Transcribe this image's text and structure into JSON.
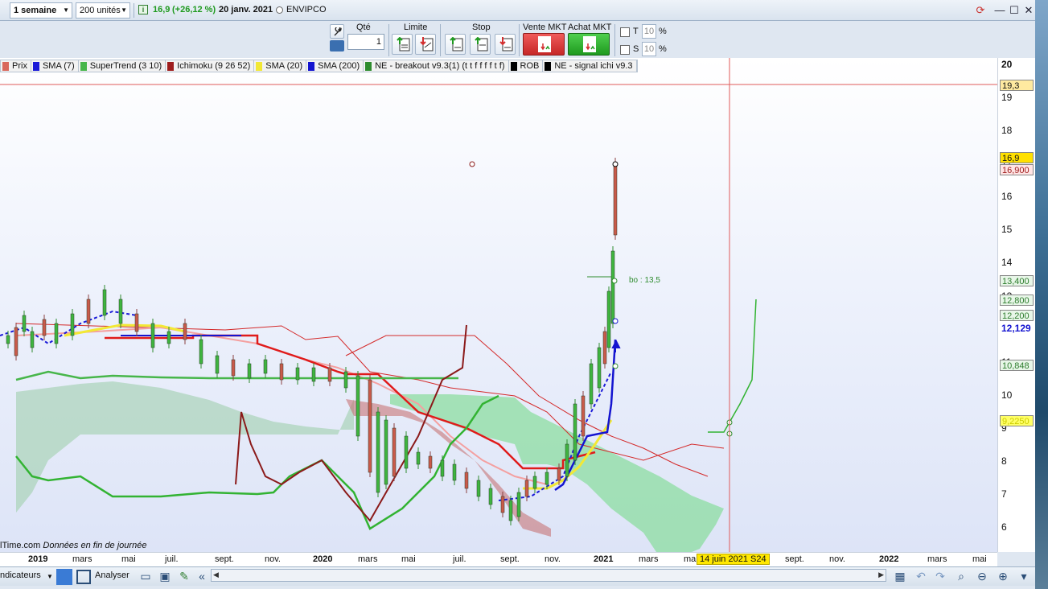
{
  "topbar": {
    "period": "1 semaine",
    "units": "200 unités",
    "price": "16,9",
    "change": "(+26,12 %)",
    "date": "20 janv. 2021",
    "ticker": "ENVIPCO"
  },
  "order_toolbar": {
    "qte_label": "Qté",
    "qte_value": "1",
    "limite_label": "Limite",
    "stop_label": "Stop",
    "vente_label": "Vente MKT",
    "achat_label": "Achat MKT",
    "t_label": "T",
    "s_label": "S",
    "t_value": "10",
    "s_value": "10",
    "pct": "%"
  },
  "legend": [
    {
      "label": "Prix",
      "color": "#d9685c"
    },
    {
      "label": "SMA (7)",
      "color": "#1a1ad8"
    },
    {
      "label": "SuperTrend (3 10)",
      "color": "#47b64a"
    },
    {
      "label": "Ichimoku (9 26 52)",
      "color": "#9e1d1d"
    },
    {
      "label": "SMA (20)",
      "color": "#f2e835"
    },
    {
      "label": "SMA (200)",
      "color": "#1414d0"
    },
    {
      "label": "NE - breakout v9.3(1) (t t f f f f t f)",
      "color": "#2e8c2e"
    },
    {
      "label": "ROB",
      "color": "#000000"
    },
    {
      "label": "NE - signal ichi v9.3",
      "color": "#000000"
    }
  ],
  "y_axis": {
    "ticks": [
      "20",
      "19",
      "18",
      "17",
      "16",
      "15",
      "14",
      "13",
      "12",
      "11",
      "10",
      "9",
      "8",
      "7",
      "6"
    ],
    "tags": [
      {
        "label": "19,3",
        "bg": "#ffeaa0",
        "fg": "#111111"
      },
      {
        "label": "16,9",
        "bg": "#ffe000",
        "fg": "#111111"
      },
      {
        "label": "16,900",
        "bg": "#ffe4e4",
        "fg": "#9e1d1d"
      },
      {
        "label": "13,400",
        "bg": "#e8f6e8",
        "fg": "#2e7d2e"
      },
      {
        "label": "12,800",
        "bg": "#e8f6e8",
        "fg": "#2e7d2e"
      },
      {
        "label": "12,200",
        "bg": "#e8f6e8",
        "fg": "#2e7d2e"
      },
      {
        "label": "12,129",
        "bg": "#ffffff",
        "fg": "#1414d0"
      },
      {
        "label": "10,848",
        "bg": "#e8f6e8",
        "fg": "#2e7d2e"
      },
      {
        "label": "9,2250",
        "bg": "#ffff66",
        "fg": "#cccc00"
      }
    ]
  },
  "time_axis": [
    "2019",
    "mars",
    "mai",
    "juil.",
    "sept.",
    "nov.",
    "2020",
    "mars",
    "mai",
    "juil.",
    "sept.",
    "nov.",
    "2021",
    "mars",
    "mai",
    "sept.",
    "nov.",
    "2022",
    "mars",
    "mai"
  ],
  "crosshair_date": "14 juin 2021 S24",
  "annotation": "bo : 13,5",
  "footer_note_prefix": "lTime.com",
  "footer_note": "Données en fin de journée",
  "bottombar": {
    "indicators": "ndicateurs",
    "analyser": "Analyser"
  },
  "chart_data": {
    "type": "line",
    "title": "ENVIPCO",
    "xlabel": "",
    "ylabel": "",
    "ylim": [
      5.5,
      20.5
    ],
    "series": [
      {
        "name": "Prix",
        "x": [
          "2019-01",
          "2019-02",
          "2019-03",
          "2019-04",
          "2019-05",
          "2019-06",
          "2019-07",
          "2019-08",
          "2019-09",
          "2019-10",
          "2019-11",
          "2019-12",
          "2020-01",
          "2020-02",
          "2020-03",
          "2020-04",
          "2020-05",
          "2020-06",
          "2020-07",
          "2020-08",
          "2020-09",
          "2020-10",
          "2020-11",
          "2020-12",
          "2021-01"
        ],
        "values": [
          11.6,
          12.0,
          12.6,
          12.9,
          11.7,
          11.4,
          11.8,
          11.0,
          10.9,
          10.9,
          10.8,
          10.7,
          10.8,
          10.5,
          7.3,
          8.0,
          8.0,
          7.8,
          7.5,
          7.0,
          6.6,
          7.0,
          7.6,
          10.2,
          16.9
        ]
      }
    ]
  }
}
